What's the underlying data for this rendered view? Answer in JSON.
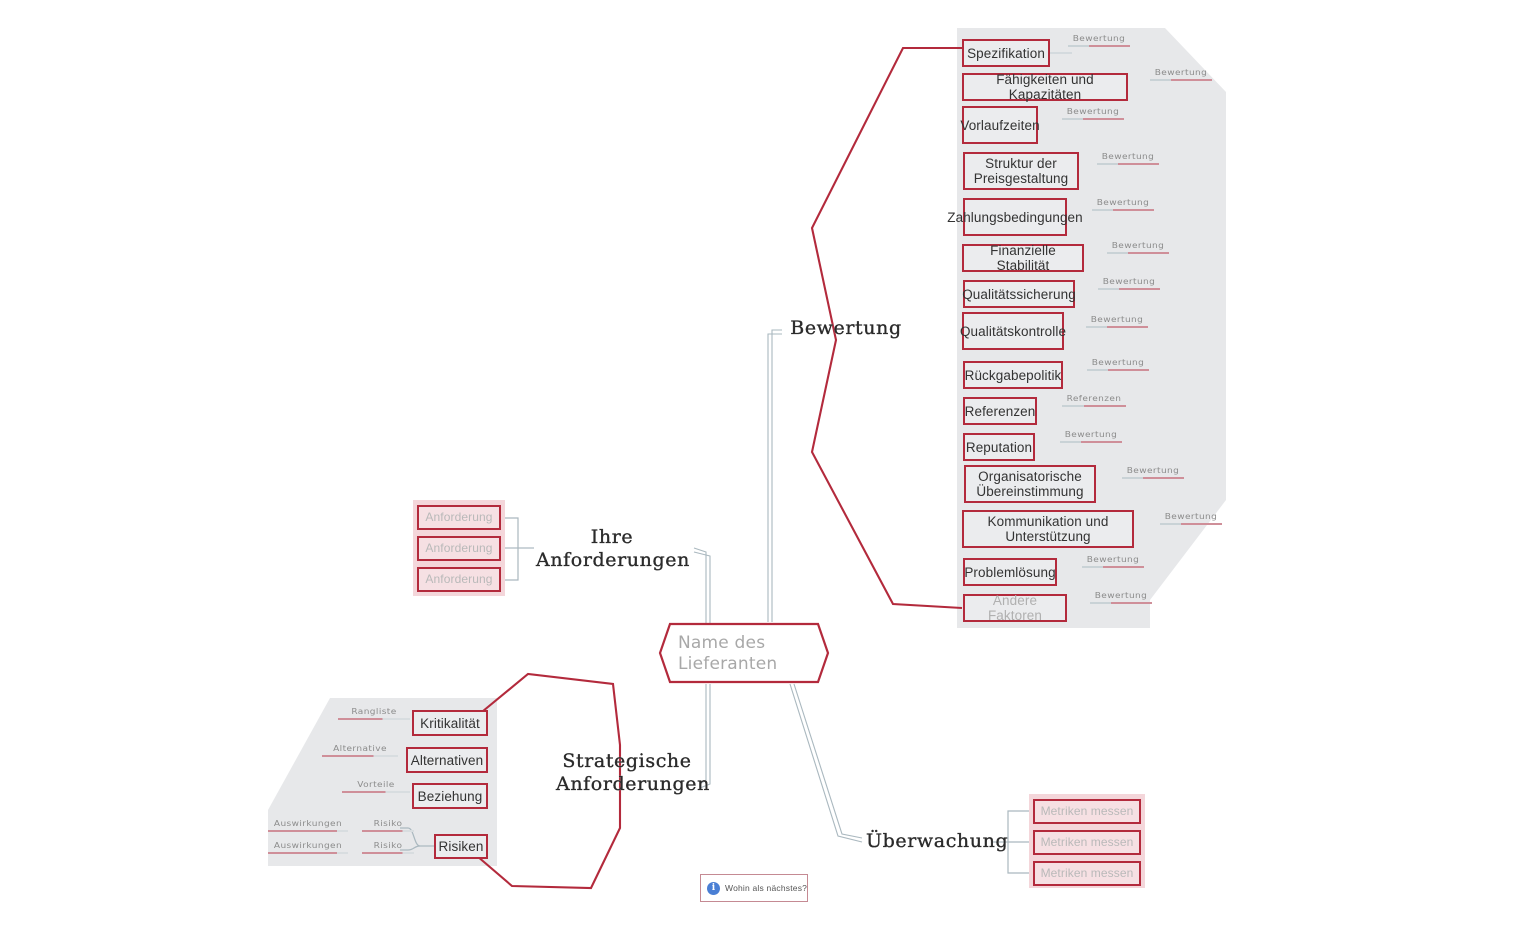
{
  "central": {
    "label": "Name des Lieferanten"
  },
  "branches": {
    "bewertung": {
      "heading": "Bewertung",
      "items": [
        {
          "label": "Spezifikation",
          "sub": "Bewertung"
        },
        {
          "label": "Fähigkeiten und Kapazitäten",
          "sub": "Bewertung"
        },
        {
          "label": "Vorlaufzeiten",
          "sub": "Bewertung"
        },
        {
          "label": "Struktur der Preisgestaltung",
          "sub": "Bewertung"
        },
        {
          "label": "Zahlungsbedingungen",
          "sub": "Bewertung"
        },
        {
          "label": "Finanzielle Stabilität",
          "sub": "Bewertung"
        },
        {
          "label": "Qualitätssicherung",
          "sub": "Bewertung"
        },
        {
          "label": "Qualitätskontrolle",
          "sub": "Bewertung"
        },
        {
          "label": "Rückgabepolitik",
          "sub": "Bewertung"
        },
        {
          "label": "Referenzen",
          "sub": "Referenzen"
        },
        {
          "label": "Reputation",
          "sub": "Bewertung"
        },
        {
          "label": "Organisatorische Übereinstimmung",
          "sub": "Bewertung"
        },
        {
          "label": "Kommunikation und Unterstützung",
          "sub": "Bewertung"
        },
        {
          "label": "Problemlösung",
          "sub": "Bewertung"
        },
        {
          "label": "Andere Faktoren",
          "sub": "Bewertung"
        }
      ]
    },
    "anforderungen": {
      "heading": "Ihre Anforderungen",
      "items": [
        {
          "label": "Anforderung"
        },
        {
          "label": "Anforderung"
        },
        {
          "label": "Anforderung"
        }
      ]
    },
    "strategische": {
      "heading": "Strategische Anforderungen",
      "items": [
        {
          "label": "Kritikalität",
          "sub": "Rangliste"
        },
        {
          "label": "Alternativen",
          "sub": "Alternative"
        },
        {
          "label": "Beziehung",
          "sub": "Vorteile"
        },
        {
          "label": "Risiken",
          "risks": [
            {
              "risk": "Risiko",
              "impact": "Auswirkungen"
            },
            {
              "risk": "Risiko",
              "impact": "Auswirkungen"
            }
          ]
        }
      ]
    },
    "ueberwachung": {
      "heading": "Überwachung",
      "items": [
        {
          "label": "Metriken messen"
        },
        {
          "label": "Metriken messen"
        },
        {
          "label": "Metriken messen"
        }
      ]
    }
  },
  "hint": {
    "icon": "info-icon",
    "text": "Wohin als nächstes?"
  },
  "colors": {
    "accent": "#b32a3c",
    "box_fill": "#ebecee",
    "group_shade": "#e7e8ea",
    "pink_shade": "#f4d6da",
    "connector": "#aab8bf",
    "placeholder_text": "#b0b0b0",
    "sub_rule": "#cf8f99"
  }
}
